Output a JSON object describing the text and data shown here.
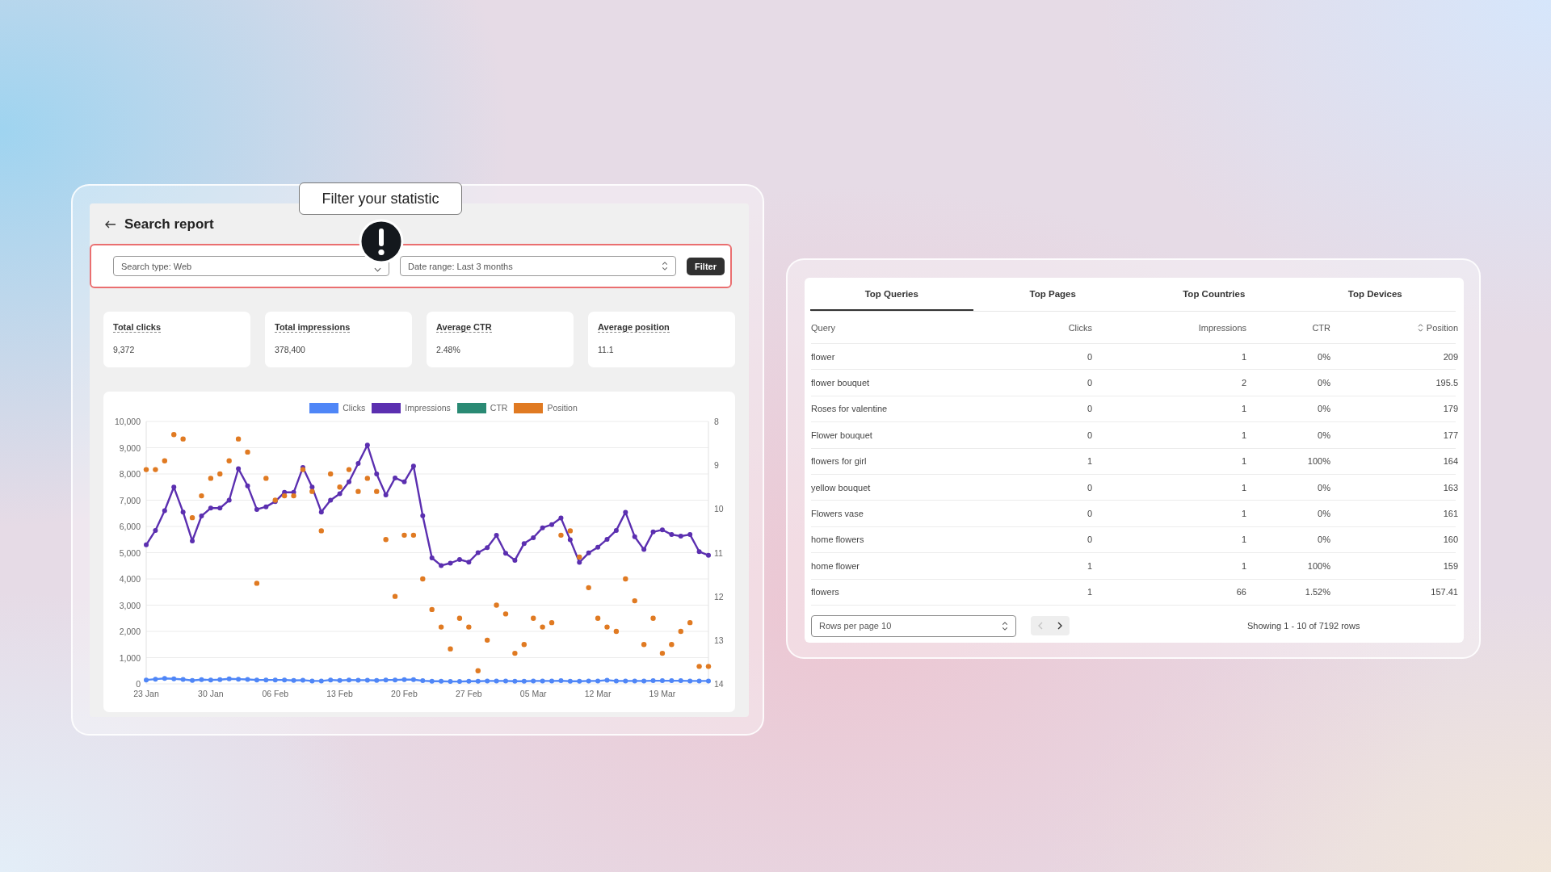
{
  "report": {
    "title": "Search report",
    "tooltip": "Filter your statistic",
    "filters": [
      {
        "label": "Search type: Web",
        "kind": "dropdown"
      },
      {
        "label": "Date range: Last 3 months",
        "kind": "stepper"
      }
    ],
    "filter_button": "Filter",
    "stats": [
      {
        "label": "Total clicks",
        "value": "9,372"
      },
      {
        "label": "Total impressions",
        "value": "378,400"
      },
      {
        "label": "Average CTR",
        "value": "2.48%"
      },
      {
        "label": "Average position",
        "value": "11.1"
      }
    ],
    "chart_data": {
      "type": "line",
      "categories": [
        "23 Jan",
        null,
        null,
        null,
        null,
        null,
        null,
        "30 Jan",
        null,
        null,
        null,
        null,
        null,
        null,
        "06 Feb",
        null,
        null,
        null,
        null,
        null,
        null,
        "13 Feb",
        null,
        null,
        null,
        null,
        null,
        null,
        "20 Feb",
        null,
        null,
        null,
        null,
        null,
        null,
        "27 Feb",
        null,
        null,
        null,
        null,
        null,
        null,
        "05 Mar",
        null,
        null,
        null,
        null,
        null,
        null,
        "12 Mar",
        null,
        null,
        null,
        null,
        null,
        null,
        "19 Mar",
        null,
        null,
        null,
        null,
        null
      ],
      "ylim": [
        0,
        10000
      ],
      "y2lim": [
        14,
        8
      ],
      "grid": true,
      "legend": "top",
      "yticks": [
        0,
        {
          "value": 1000,
          "label": "1,000"
        },
        {
          "value": 2000,
          "label": "2,000"
        },
        {
          "value": 3000,
          "label": "3,000"
        },
        {
          "value": 4000,
          "label": "4,000"
        },
        {
          "value": 5000,
          "label": "5,000"
        },
        {
          "value": 6000,
          "label": "6,000"
        },
        {
          "value": 7000,
          "label": "7,000"
        },
        {
          "value": 8000,
          "label": "8,000"
        },
        {
          "value": 9000,
          "label": "9,000"
        },
        {
          "value": 10000,
          "label": "10,000"
        }
      ],
      "y2ticks": [
        8,
        9,
        10,
        11,
        12,
        13,
        14
      ],
      "series": [
        {
          "name": "Clicks",
          "color": "#4f86f7",
          "marker": "circle",
          "values": [
            150,
            180,
            210,
            190,
            170,
            130,
            160,
            150,
            160,
            190,
            180,
            170,
            150,
            150,
            150,
            150,
            130,
            140,
            110,
            110,
            150,
            130,
            150,
            140,
            140,
            130,
            150,
            150,
            160,
            160,
            120,
            100,
            100,
            90,
            90,
            100,
            100,
            110,
            110,
            110,
            100,
            100,
            110,
            110,
            110,
            120,
            100,
            100,
            110,
            110,
            140,
            110,
            110,
            110,
            110,
            120,
            120,
            120,
            120,
            110,
            110,
            110
          ]
        },
        {
          "name": "Impressions",
          "color": "#5b2fb0",
          "marker": "circle",
          "values": [
            5300,
            5850,
            6600,
            7500,
            6550,
            5450,
            6400,
            6700,
            6700,
            7000,
            8200,
            7550,
            6650,
            6750,
            6950,
            7300,
            7300,
            8250,
            7500,
            6550,
            7000,
            7250,
            7700,
            8400,
            9100,
            8000,
            7200,
            7850,
            7700,
            8300,
            6410,
            4800,
            4510,
            4600,
            4740,
            4640,
            5000,
            5190,
            5660,
            4980,
            4710,
            5350,
            5570,
            5950,
            6070,
            6320,
            5490,
            4630,
            4990,
            5210,
            5510,
            5850,
            6540,
            5610,
            5120,
            5790,
            5870,
            5690,
            5630,
            5690,
            5040,
            4900
          ]
        },
        {
          "name": "CTR",
          "color": "#2a8a74",
          "values": [
            null,
            null,
            null,
            null,
            null,
            null,
            null,
            null,
            null,
            null,
            null,
            null,
            null,
            null,
            null,
            null,
            null,
            null,
            null,
            null,
            null,
            null,
            null,
            null,
            null,
            null,
            null,
            null,
            null,
            null,
            null,
            null,
            null,
            null,
            null,
            null,
            null,
            null,
            null,
            null,
            null,
            null,
            null,
            null,
            null,
            null,
            null,
            null,
            null,
            null,
            null,
            null,
            null,
            null,
            null,
            null,
            null,
            null,
            null,
            null,
            null,
            null
          ]
        },
        {
          "name": "Position",
          "color": "#e07a22",
          "axis": "y2",
          "type": "scatter",
          "values": [
            9.1,
            9.1,
            8.9,
            8.3,
            8.4,
            10.2,
            9.7,
            9.3,
            9.2,
            8.9,
            8.4,
            8.7,
            11.7,
            9.3,
            9.8,
            9.7,
            9.7,
            9.1,
            9.6,
            10.5,
            9.2,
            9.5,
            9.1,
            9.6,
            9.3,
            9.6,
            10.7,
            12.0,
            10.6,
            10.6,
            11.6,
            12.3,
            12.7,
            13.2,
            12.5,
            12.7,
            13.7,
            13.0,
            12.2,
            12.4,
            13.3,
            13.1,
            12.5,
            12.7,
            12.6,
            10.6,
            10.5,
            11.1,
            11.8,
            12.5,
            12.7,
            12.8,
            11.6,
            12.1,
            13.1,
            12.5,
            13.3,
            13.1,
            12.8,
            12.6,
            13.6,
            13.6
          ]
        }
      ]
    }
  },
  "table_panel": {
    "tabs": [
      {
        "label": "Top Queries",
        "selected": true
      },
      {
        "label": "Top Pages",
        "selected": false
      },
      {
        "label": "Top Countries",
        "selected": false
      },
      {
        "label": "Top Devices",
        "selected": false
      }
    ],
    "columns": [
      {
        "label": "Query",
        "sorted": false
      },
      {
        "label": "Clicks",
        "sorted": false
      },
      {
        "label": "Impressions",
        "sorted": false
      },
      {
        "label": "CTR",
        "sorted": false
      },
      {
        "label": "Position",
        "sorted": true
      }
    ],
    "rows": [
      [
        "flower",
        "0",
        "1",
        "0%",
        "209"
      ],
      [
        "flower bouquet",
        "0",
        "2",
        "0%",
        "195.5"
      ],
      [
        "Roses for valentine",
        "0",
        "1",
        "0%",
        "179"
      ],
      [
        "Flower bouquet",
        "0",
        "1",
        "0%",
        "177"
      ],
      [
        "flowers for girl",
        "1",
        "1",
        "100%",
        "164"
      ],
      [
        "yellow bouquet",
        "0",
        "1",
        "0%",
        "163"
      ],
      [
        "Flowers vase",
        "0",
        "1",
        "0%",
        "161"
      ],
      [
        "home flowers",
        "0",
        "1",
        "0%",
        "160"
      ],
      [
        "home flower",
        "1",
        "1",
        "100%",
        "159"
      ],
      [
        "flowers",
        "1",
        "66",
        "1.52%",
        "157.41"
      ]
    ],
    "rows_per_page": "Rows per page 10",
    "pager": [
      {
        "kind": "prev",
        "disabled": true
      },
      {
        "kind": "next",
        "disabled": false
      }
    ],
    "summary": "Showing 1 - 10 of 7192 rows"
  }
}
